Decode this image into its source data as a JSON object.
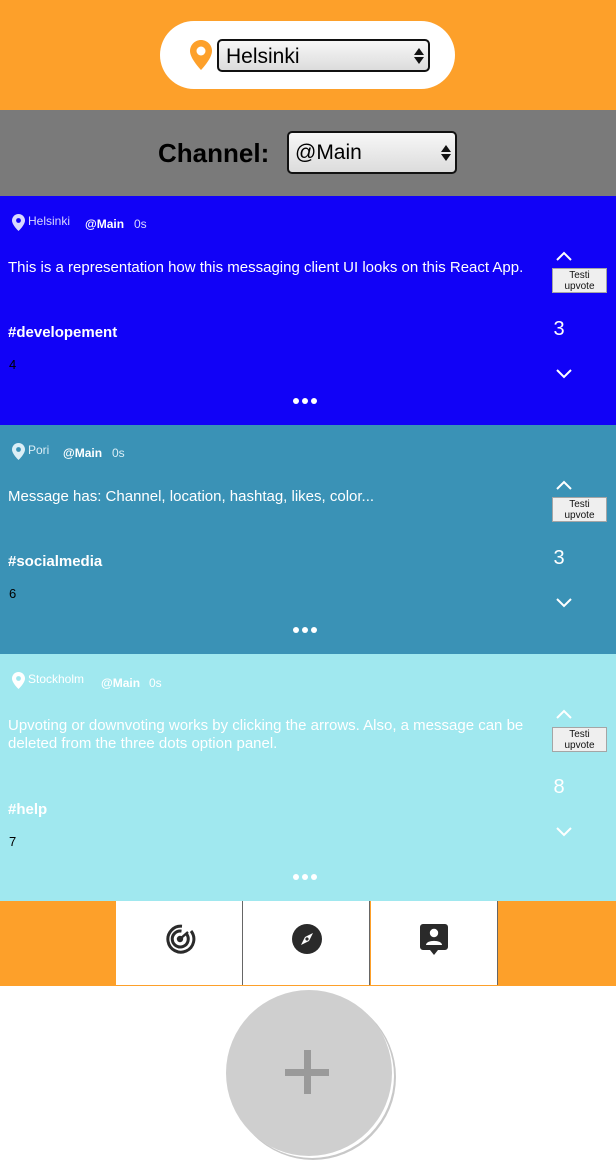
{
  "location": {
    "selected": "Helsinki",
    "pin_icon": "location-pin-icon",
    "pin_color": "#fda02a"
  },
  "channel": {
    "label": "Channel:",
    "selected": "@Main"
  },
  "messages": [
    {
      "location": "Helsinki",
      "channel": "@Main",
      "age": "0s",
      "text": "This is a representation how this messaging client UI looks on this React App.",
      "hashtag": "#developement",
      "number": "4",
      "vote_button": "Testi upvote",
      "votes": "3",
      "background": "#1102f7"
    },
    {
      "location": "Pori",
      "channel": "@Main",
      "age": "0s",
      "text": "Message has: Channel, location, hashtag, likes, color...",
      "hashtag": "#socialmedia",
      "number": "6",
      "vote_button": "Testi upvote",
      "votes": "3",
      "background": "#3a92b6"
    },
    {
      "location": "Stockholm",
      "channel": "@Main",
      "age": "0s",
      "text": "Upvoting or downvoting works by clicking the arrows. Also, a message can be deleted from the three dots option panel.",
      "hashtag": "#help",
      "number": "7",
      "vote_button": "Testi upvote",
      "votes": "8",
      "background": "#a0e8ef"
    }
  ],
  "nav": {
    "tabs": [
      {
        "icon": "radar-icon"
      },
      {
        "icon": "compass-icon"
      },
      {
        "icon": "contact-icon"
      }
    ],
    "background": "#fda02a"
  },
  "fab": {
    "icon": "plus-icon"
  }
}
